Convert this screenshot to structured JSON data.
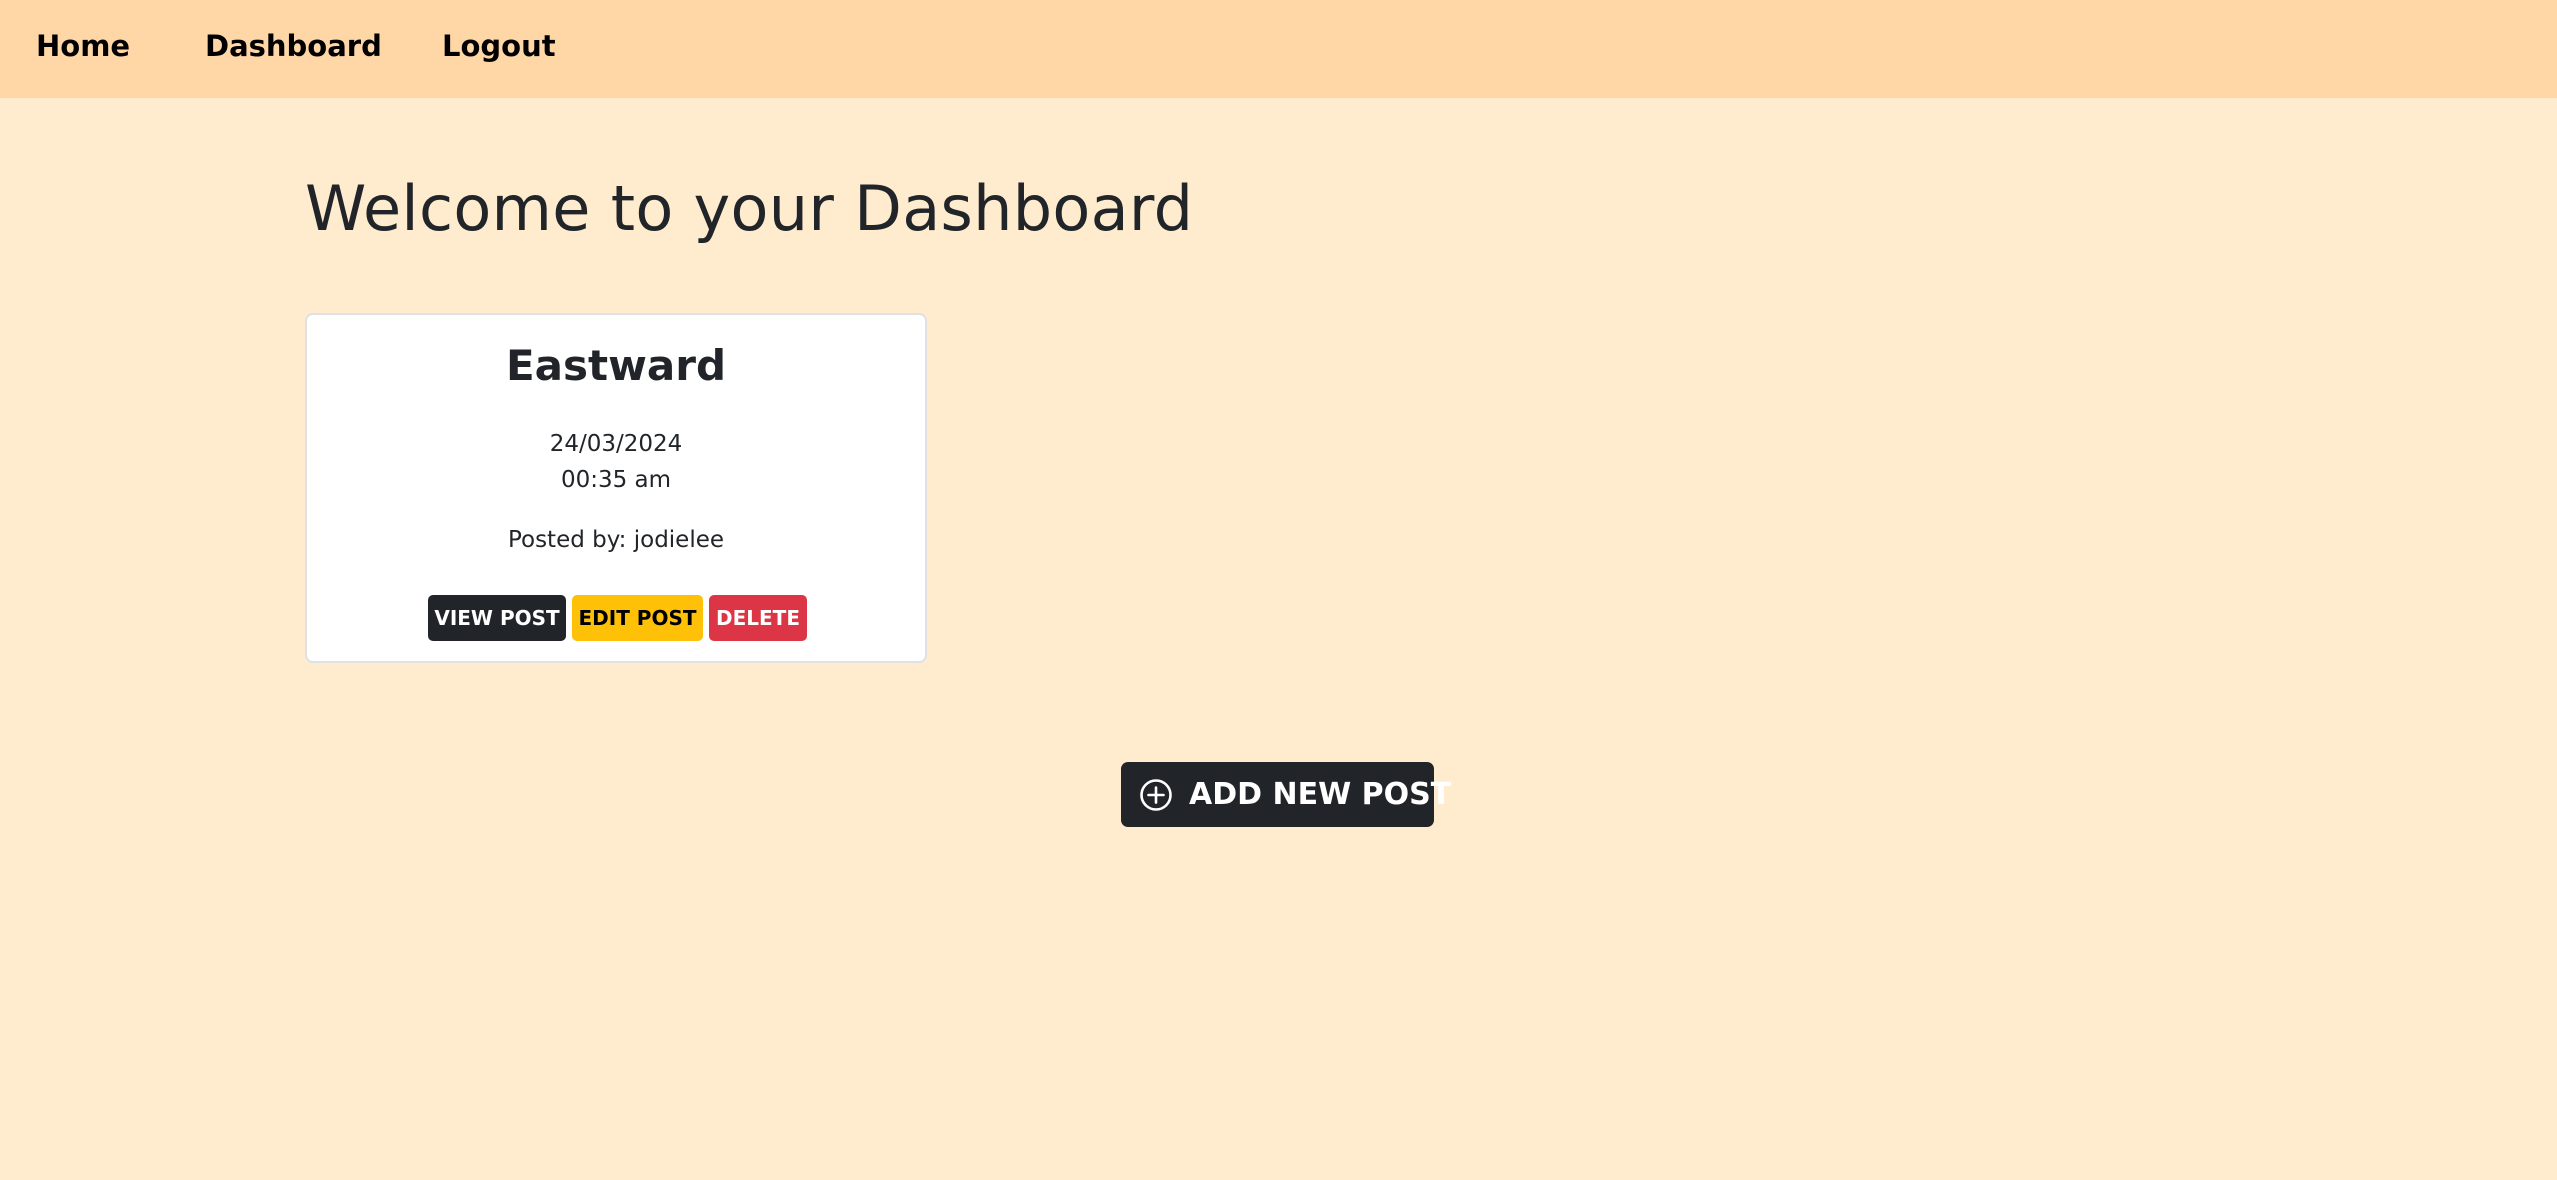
{
  "nav": {
    "home": "Home",
    "dashboard": "Dashboard",
    "logout": "Logout"
  },
  "page": {
    "title": "Welcome to your Dashboard"
  },
  "posts": [
    {
      "title": "Eastward",
      "date": "24/03/2024",
      "time": "00:35 am",
      "author": "Posted by: jodielee",
      "view_label": "VIEW POST",
      "edit_label": "EDIT POST",
      "delete_label": "DELETE"
    }
  ],
  "actions": {
    "add_post_label": "ADD NEW POST",
    "add_post_icon": "plus-circle-icon"
  },
  "colors": {
    "background": "#ffecce",
    "navbar": "#ffd6a6",
    "dark": "#212529",
    "warning": "#ffc107",
    "danger": "#dc3545"
  }
}
